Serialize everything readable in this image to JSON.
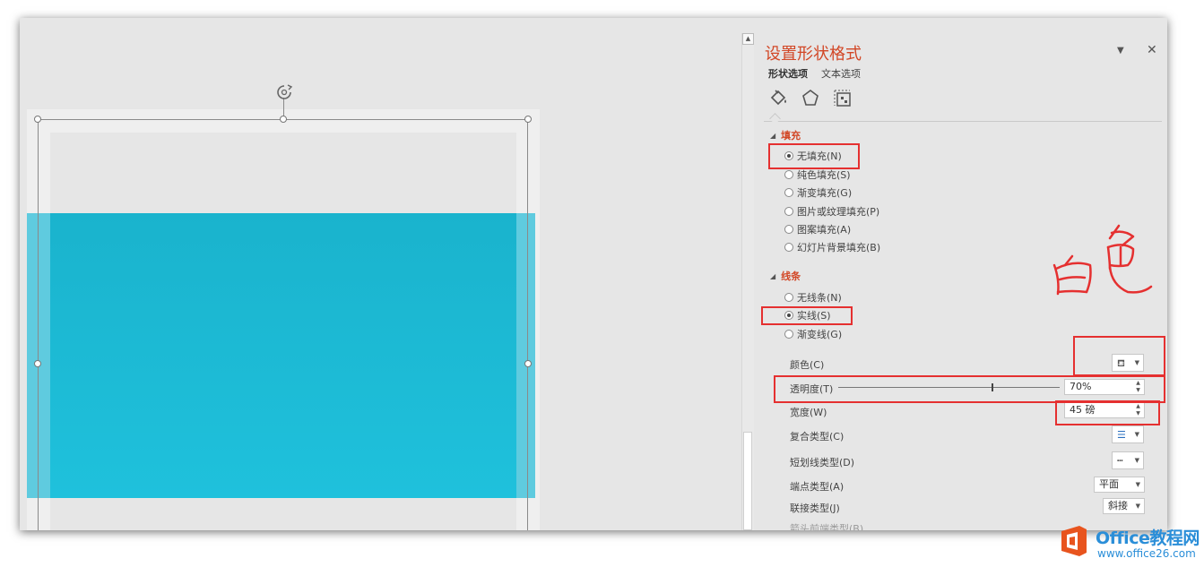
{
  "pane": {
    "title": "设置形状格式",
    "tabs": [
      "形状选项",
      "文本选项"
    ],
    "category_icons": [
      "fill-line-icon",
      "effects-pentagon-icon",
      "size-properties-icon"
    ],
    "fill": {
      "heading": "填充",
      "options": [
        "无填充(N)",
        "纯色填充(S)",
        "渐变填充(G)",
        "图片或纹理填充(P)",
        "图案填充(A)",
        "幻灯片背景填充(B)"
      ],
      "selected": "无填充(N)"
    },
    "line": {
      "heading": "线条",
      "options": [
        "无线条(N)",
        "实线(S)",
        "渐变线(G)"
      ],
      "selected": "实线(S)",
      "color_label": "颜色(C)",
      "transparency_label": "透明度(T)",
      "transparency_value": "70%",
      "transparency_percent": 70,
      "width_label": "宽度(W)",
      "width_value": "45 磅",
      "compound_label": "复合类型(C)",
      "dash_label": "短划线类型(D)",
      "cap_label": "端点类型(A)",
      "cap_value": "平面",
      "join_label": "联接类型(J)",
      "join_value": "斜接",
      "arrow_label": "箭头前端类型(B)"
    }
  },
  "annotation": {
    "handwritten_text": "白色",
    "color": "#e53030"
  },
  "watermark": {
    "brand": "Office教程网",
    "url": "www.office26.com"
  },
  "colors": {
    "accent": "#d24726",
    "shape_fill": "#1eb8d3",
    "shape_outline": "#5fcbdf"
  }
}
